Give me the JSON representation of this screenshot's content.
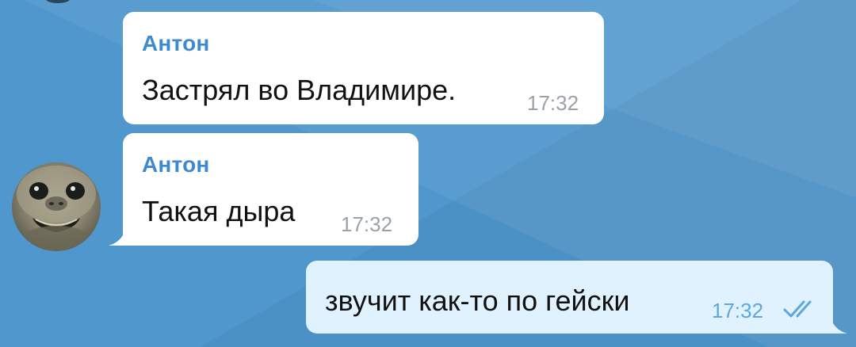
{
  "chat": {
    "messages": [
      {
        "sender": "Антон",
        "text": "Застрял во Владимире.",
        "time": "17:32"
      },
      {
        "sender": "Антон",
        "text": "Такая дыра",
        "time": "17:32"
      },
      {
        "text": "звучит как-то по гейски",
        "time": "17:32",
        "status_icon": "double-check-icon"
      }
    ]
  },
  "colors": {
    "background": "#4f97cd",
    "incoming_bubble": "#ffffff",
    "outgoing_bubble": "#dff2fd",
    "sender_name": "#3b8ad2",
    "time_incoming": "#9aa2aa",
    "time_outgoing": "#5fa5df"
  },
  "avatar": {
    "icon": "seal-avatar"
  }
}
